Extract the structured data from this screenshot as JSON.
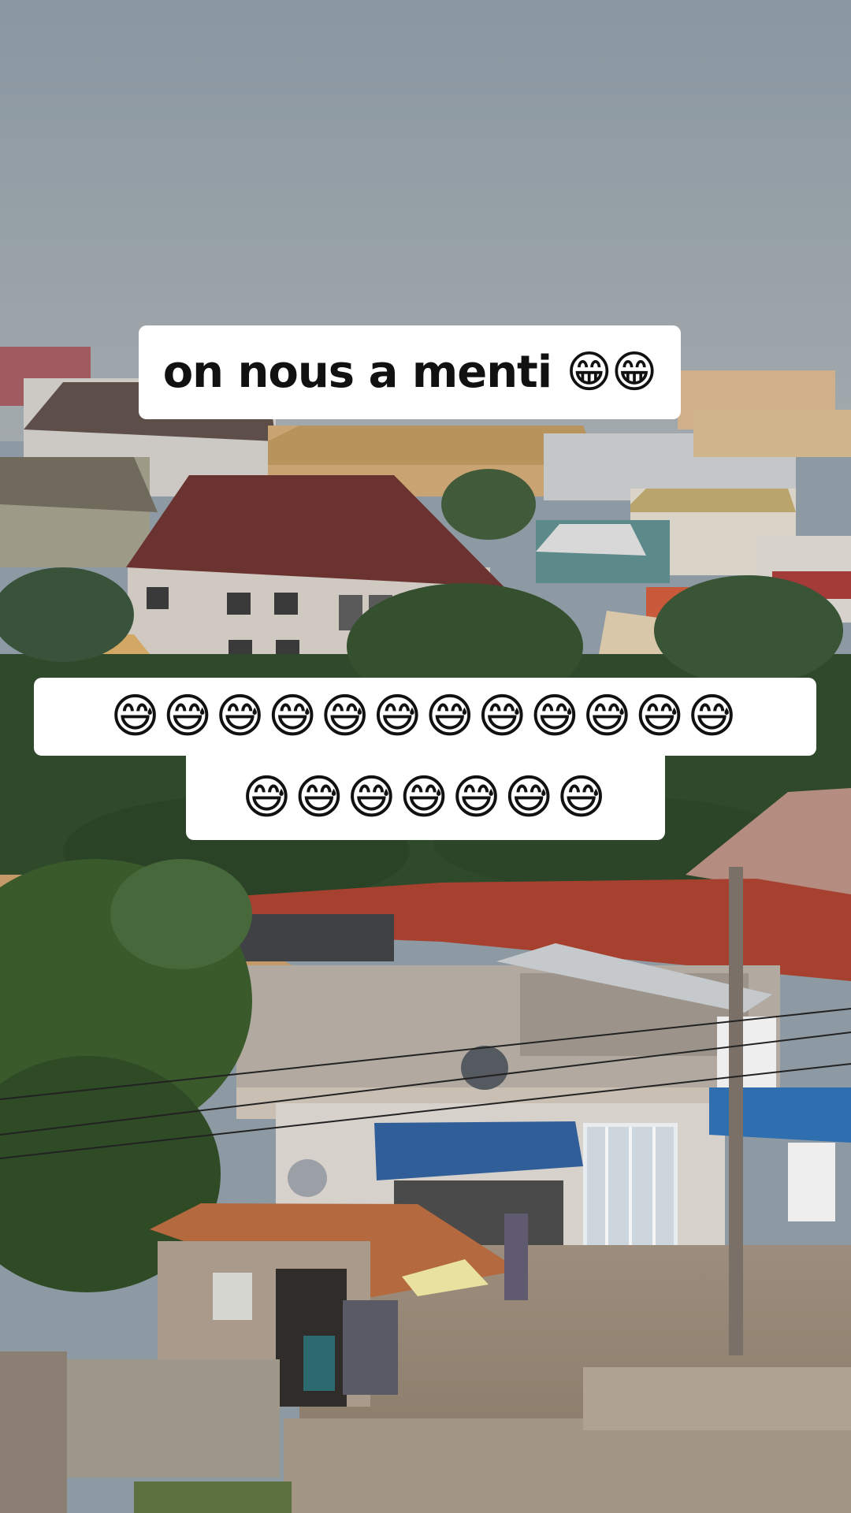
{
  "captions": {
    "line1": "on nous a menti 😁😁",
    "line2": "😅😅😅😅😅😅😅😅😅😅😅😅",
    "line3": "😅😅😅😅😅😅😅"
  },
  "colors": {
    "sky": "#8e9aa3",
    "roof_red": "#a7412f",
    "roof_rust": "#b4693f",
    "foliage": "#2f4a2a",
    "awning_blue": "#2f6fb0"
  }
}
